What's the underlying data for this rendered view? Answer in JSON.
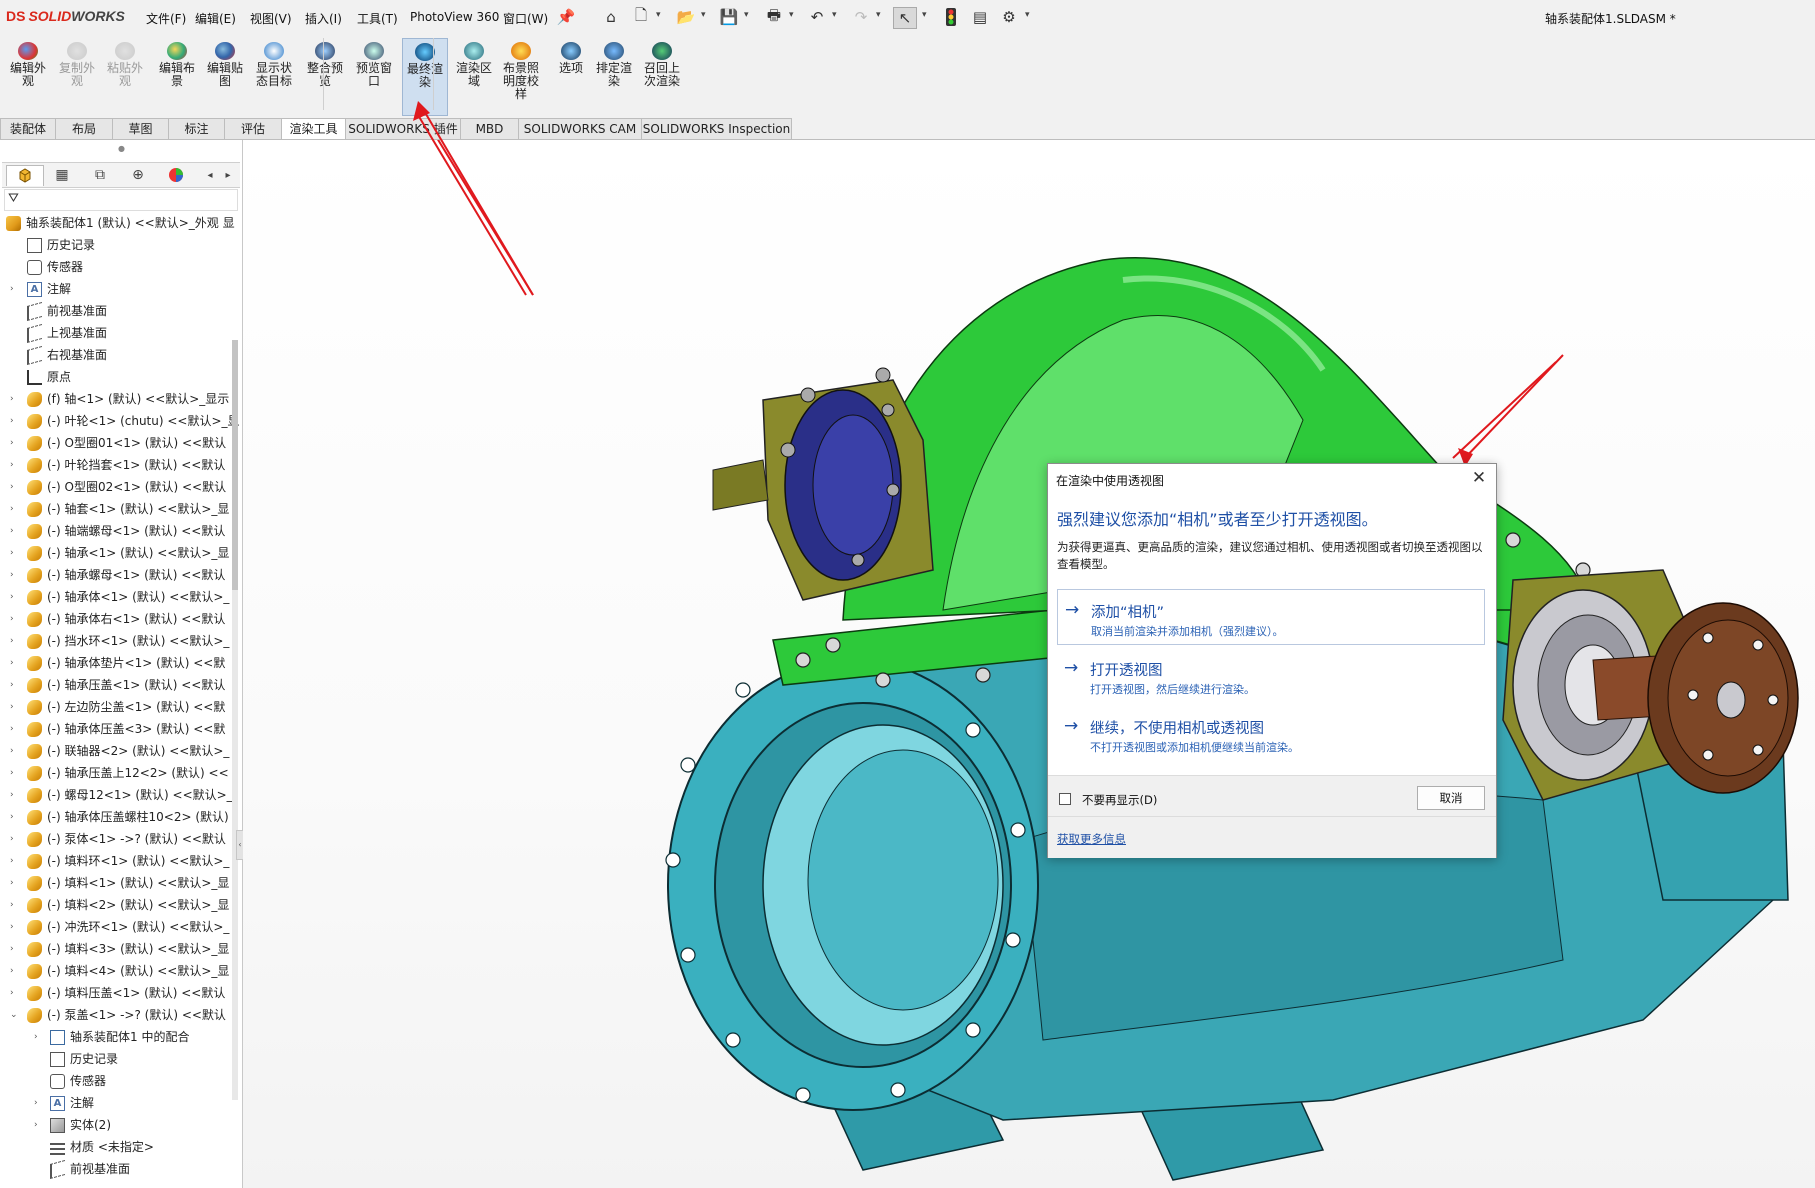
{
  "app": {
    "logo_prefix": "DS",
    "logo_solid": "SOLID",
    "logo_works": "WORKS",
    "document_title": "轴系装配体1.SLDASM *"
  },
  "menu": [
    "文件(F)",
    "编辑(E)",
    "视图(V)",
    "插入(I)",
    "工具(T)",
    "PhotoView 360",
    "窗口(W)"
  ],
  "quick_access": {
    "pin_icon": "pin-icon",
    "icons": [
      "home-icon",
      "new-document-icon",
      "open-folder-icon",
      "save-icon",
      "print-icon",
      "undo-icon",
      "redo-icon",
      "select-pointer-icon",
      "traffic-light-icon",
      "file-properties-icon",
      "options-gear-icon"
    ]
  },
  "toolbar": {
    "buttons": [
      {
        "label": "编辑外观",
        "icon": "edit-appearance-icon",
        "enabled": true
      },
      {
        "label": "复制外观",
        "icon": "copy-appearance-icon",
        "enabled": false
      },
      {
        "label": "粘贴外观",
        "icon": "paste-appearance-icon",
        "enabled": false
      },
      {
        "label": "编辑布景",
        "icon": "edit-scene-icon",
        "enabled": true
      },
      {
        "label": "编辑贴图",
        "icon": "edit-decal-icon",
        "enabled": true
      },
      {
        "label": "显示状态目标",
        "icon": "display-state-target-icon",
        "enabled": true
      },
      {
        "label": "整合预览",
        "icon": "integrated-preview-icon",
        "enabled": true
      },
      {
        "label": "预览窗口",
        "icon": "preview-window-icon",
        "enabled": true
      },
      {
        "label": "最终渲染",
        "icon": "final-render-icon",
        "enabled": true,
        "active": true
      },
      {
        "label": "渲染区域",
        "icon": "render-region-icon",
        "enabled": true
      },
      {
        "label": "布景照明度校样",
        "icon": "scene-illumination-proof-icon",
        "enabled": true
      },
      {
        "label": "选项",
        "icon": "render-options-icon",
        "enabled": true
      },
      {
        "label": "排定渲染",
        "icon": "schedule-render-icon",
        "enabled": true
      },
      {
        "label": "召回上次渲染",
        "icon": "recall-last-render-icon",
        "enabled": true
      }
    ]
  },
  "command_tabs": [
    {
      "label": "装配体",
      "active": false
    },
    {
      "label": "布局",
      "active": false
    },
    {
      "label": "草图",
      "active": false
    },
    {
      "label": "标注",
      "active": false
    },
    {
      "label": "评估",
      "active": false
    },
    {
      "label": "渲染工具",
      "active": true
    },
    {
      "label": "SOLIDWORKS 插件",
      "active": false
    },
    {
      "label": "MBD",
      "active": false
    },
    {
      "label": "SOLIDWORKS CAM",
      "active": false
    },
    {
      "label": "SOLIDWORKS Inspection",
      "active": false
    }
  ],
  "feature_manager": {
    "tab_icons": [
      "feature-manager-tree-icon",
      "property-manager-icon",
      "configuration-manager-icon",
      "dimxpert-manager-icon",
      "display-manager-icon"
    ],
    "scroll_left_icon": "scroll-left-icon",
    "scroll_right_icon": "scroll-right-icon",
    "filter_icon": "filter-icon",
    "tree": [
      {
        "label": "轴系装配体1 (默认) <<默认>_外观 显",
        "icon": "assembly",
        "indent": 0,
        "expander": "",
        "name": "tree-root-assembly"
      },
      {
        "label": "历史记录",
        "icon": "doc",
        "indent": 1,
        "expander": "",
        "name": "tree-history"
      },
      {
        "label": "传感器",
        "icon": "sensor",
        "indent": 1,
        "expander": "",
        "name": "tree-sensors"
      },
      {
        "label": "注解",
        "icon": "annot",
        "indent": 1,
        "expander": "›",
        "name": "tree-annotations"
      },
      {
        "label": "前视基准面",
        "icon": "plane",
        "indent": 1,
        "expander": "",
        "name": "tree-front-plane"
      },
      {
        "label": "上视基准面",
        "icon": "plane",
        "indent": 1,
        "expander": "",
        "name": "tree-top-plane"
      },
      {
        "label": "右视基准面",
        "icon": "plane",
        "indent": 1,
        "expander": "",
        "name": "tree-right-plane"
      },
      {
        "label": "原点",
        "icon": "origin",
        "indent": 1,
        "expander": "",
        "name": "tree-origin"
      },
      {
        "label": "(f) 轴<1> (默认) <<默认>_显示",
        "icon": "part",
        "indent": 1,
        "expander": "›",
        "name": "tree-component"
      },
      {
        "label": "(-) 叶轮<1> (chutu) <<默认>_显",
        "icon": "part",
        "indent": 1,
        "expander": "›",
        "name": "tree-component"
      },
      {
        "label": "(-) O型圈01<1> (默认) <<默认",
        "icon": "part",
        "indent": 1,
        "expander": "›",
        "name": "tree-component"
      },
      {
        "label": "(-) 叶轮挡套<1> (默认) <<默认",
        "icon": "part",
        "indent": 1,
        "expander": "›",
        "name": "tree-component"
      },
      {
        "label": "(-) O型圈02<1> (默认) <<默认",
        "icon": "part",
        "indent": 1,
        "expander": "›",
        "name": "tree-component"
      },
      {
        "label": "(-) 轴套<1> (默认) <<默认>_显",
        "icon": "part",
        "indent": 1,
        "expander": "›",
        "name": "tree-component"
      },
      {
        "label": "(-) 轴端螺母<1> (默认) <<默认",
        "icon": "part",
        "indent": 1,
        "expander": "›",
        "name": "tree-component"
      },
      {
        "label": "(-) 轴承<1> (默认) <<默认>_显",
        "icon": "part",
        "indent": 1,
        "expander": "›",
        "name": "tree-component"
      },
      {
        "label": "(-) 轴承螺母<1> (默认) <<默认",
        "icon": "part",
        "indent": 1,
        "expander": "›",
        "name": "tree-component"
      },
      {
        "label": "(-) 轴承体<1> (默认) <<默认>_",
        "icon": "part",
        "indent": 1,
        "expander": "›",
        "name": "tree-component"
      },
      {
        "label": "(-) 轴承体右<1> (默认) <<默认",
        "icon": "part",
        "indent": 1,
        "expander": "›",
        "name": "tree-component"
      },
      {
        "label": "(-) 挡水环<1> (默认) <<默认>_",
        "icon": "part",
        "indent": 1,
        "expander": "›",
        "name": "tree-component"
      },
      {
        "label": "(-) 轴承体垫片<1> (默认) <<默",
        "icon": "part",
        "indent": 1,
        "expander": "›",
        "name": "tree-component"
      },
      {
        "label": "(-) 轴承压盖<1> (默认) <<默认",
        "icon": "part",
        "indent": 1,
        "expander": "›",
        "name": "tree-component"
      },
      {
        "label": "(-) 左边防尘盖<1> (默认) <<默",
        "icon": "part",
        "indent": 1,
        "expander": "›",
        "name": "tree-component"
      },
      {
        "label": "(-) 轴承体压盖<3> (默认) <<默",
        "icon": "part",
        "indent": 1,
        "expander": "›",
        "name": "tree-component"
      },
      {
        "label": "(-) 联轴器<2> (默认) <<默认>_",
        "icon": "part",
        "indent": 1,
        "expander": "›",
        "name": "tree-component"
      },
      {
        "label": "(-) 轴承压盖上12<2> (默认) <<",
        "icon": "part",
        "indent": 1,
        "expander": "›",
        "name": "tree-component"
      },
      {
        "label": "(-) 螺母12<1> (默认) <<默认>_",
        "icon": "part",
        "indent": 1,
        "expander": "›",
        "name": "tree-component"
      },
      {
        "label": "(-) 轴承体压盖螺柱10<2> (默认)",
        "icon": "part",
        "indent": 1,
        "expander": "›",
        "name": "tree-component"
      },
      {
        "label": "(-) 泵体<1> ->? (默认) <<默认",
        "icon": "part",
        "indent": 1,
        "expander": "›",
        "name": "tree-component"
      },
      {
        "label": "(-) 填料环<1> (默认) <<默认>_",
        "icon": "part",
        "indent": 1,
        "expander": "›",
        "name": "tree-component"
      },
      {
        "label": "(-) 填料<1> (默认) <<默认>_显",
        "icon": "part",
        "indent": 1,
        "expander": "›",
        "name": "tree-component"
      },
      {
        "label": "(-) 填料<2> (默认) <<默认>_显",
        "icon": "part",
        "indent": 1,
        "expander": "›",
        "name": "tree-component"
      },
      {
        "label": "(-) 冲洗环<1> (默认) <<默认>_",
        "icon": "part",
        "indent": 1,
        "expander": "›",
        "name": "tree-component"
      },
      {
        "label": "(-) 填料<3> (默认) <<默认>_显",
        "icon": "part",
        "indent": 1,
        "expander": "›",
        "name": "tree-component"
      },
      {
        "label": "(-) 填料<4> (默认) <<默认>_显",
        "icon": "part",
        "indent": 1,
        "expander": "›",
        "name": "tree-component"
      },
      {
        "label": "(-) 填料压盖<1> (默认) <<默认",
        "icon": "part",
        "indent": 1,
        "expander": "›",
        "name": "tree-component"
      },
      {
        "label": "(-) 泵盖<1> ->? (默认) <<默认",
        "icon": "part",
        "indent": 1,
        "expander": "⌄",
        "name": "tree-component-expanded"
      },
      {
        "label": "轴系装配体1 中的配合",
        "icon": "mate",
        "indent": 2,
        "expander": "›",
        "name": "tree-mates"
      },
      {
        "label": "历史记录",
        "icon": "doc",
        "indent": 2,
        "expander": "",
        "name": "tree-history"
      },
      {
        "label": "传感器",
        "icon": "sensor",
        "indent": 2,
        "expander": "",
        "name": "tree-sensors"
      },
      {
        "label": "注解",
        "icon": "annot",
        "indent": 2,
        "expander": "›",
        "name": "tree-annotations"
      },
      {
        "label": "实体(2)",
        "icon": "solid",
        "indent": 2,
        "expander": "›",
        "name": "tree-solid-bodies"
      },
      {
        "label": "材质 <未指定>",
        "icon": "material",
        "indent": 2,
        "expander": "",
        "name": "tree-material"
      },
      {
        "label": "前视基准面",
        "icon": "plane",
        "indent": 2,
        "expander": "",
        "name": "tree-front-plane"
      }
    ]
  },
  "dialog": {
    "title": "在渲染中使用透视图",
    "close_icon": "close-icon",
    "heading": "强烈建议您添加“相机”或者至少打开透视图。",
    "description": "为获得更逼真、更高品质的渲染，建议您通过相机、使用透视图或者切换至透视图以查看模型。",
    "options": [
      {
        "title": "添加“相机”",
        "desc": "取消当前渲染并添加相机（强烈建议）。",
        "icon": "arrow-right-icon"
      },
      {
        "title": "打开透视图",
        "desc": "打开透视图，然后继续进行渲染。",
        "icon": "arrow-right-icon"
      },
      {
        "title": "继续，不使用相机或透视图",
        "desc": "不打开透视图或添加相机便继续当前渲染。",
        "icon": "arrow-right-icon"
      }
    ],
    "checkbox_label": "不要再显示(D)",
    "checkbox_checked": false,
    "cancel_label": "取消",
    "link_label": "获取更多信息"
  },
  "colors": {
    "accent_blue": "#1f50a6",
    "pump_body_teal": "#3aa7b5",
    "pump_cover_green": "#2dc93a",
    "bearing_olive": "#8a8a2c",
    "coupling_brown": "#6b3a1e",
    "annotation_arrow_red": "#e0191e"
  }
}
